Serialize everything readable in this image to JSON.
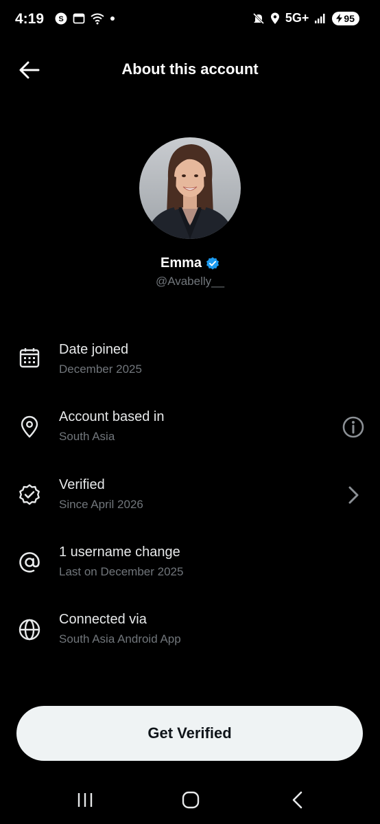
{
  "status_bar": {
    "time": "4:19",
    "network": "5G+",
    "battery": "95"
  },
  "header": {
    "title": "About this account"
  },
  "profile": {
    "name": "Emma",
    "handle": "@Avabelly__",
    "verified_badge_color": "#1d9bf0"
  },
  "rows": [
    {
      "icon": "calendar-icon",
      "title": "Date joined",
      "subtitle": "December 2025"
    },
    {
      "icon": "location-pin-icon",
      "title": "Account based in",
      "subtitle": "South Asia",
      "action": "info-icon"
    },
    {
      "icon": "verified-badge-icon",
      "title": "Verified",
      "subtitle": "Since April 2026",
      "action": "chevron-right-icon"
    },
    {
      "icon": "at-sign-icon",
      "title": "1 username change",
      "subtitle": "Last on December 2025"
    },
    {
      "icon": "globe-icon",
      "title": "Connected via",
      "subtitle": "South Asia Android App"
    }
  ],
  "cta": {
    "label": "Get Verified"
  },
  "colors": {
    "background": "#000000",
    "primary_text": "#e7e9ea",
    "secondary_text": "#71767b",
    "button_bg": "#eff3f4"
  }
}
